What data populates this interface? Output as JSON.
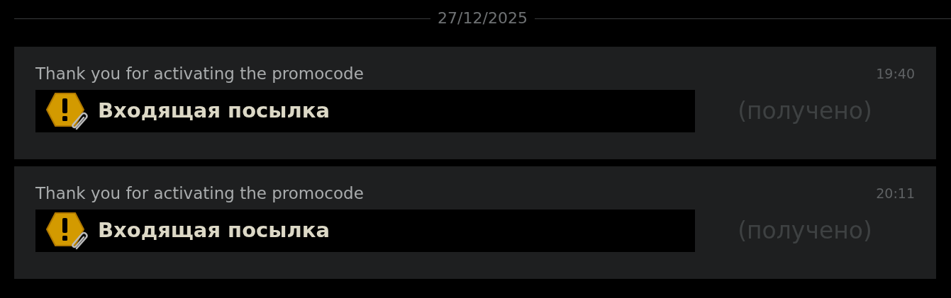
{
  "date_divider": "27/12/2025",
  "messages": [
    {
      "text": "Thank you for activating the promocode",
      "time": "19:40",
      "attachment": {
        "title": "Входящая посылка",
        "status": "(получено)"
      }
    },
    {
      "text": "Thank you for activating the promocode",
      "time": "20:11",
      "attachment": {
        "title": "Входящая посылка",
        "status": "(получено)"
      }
    }
  ]
}
